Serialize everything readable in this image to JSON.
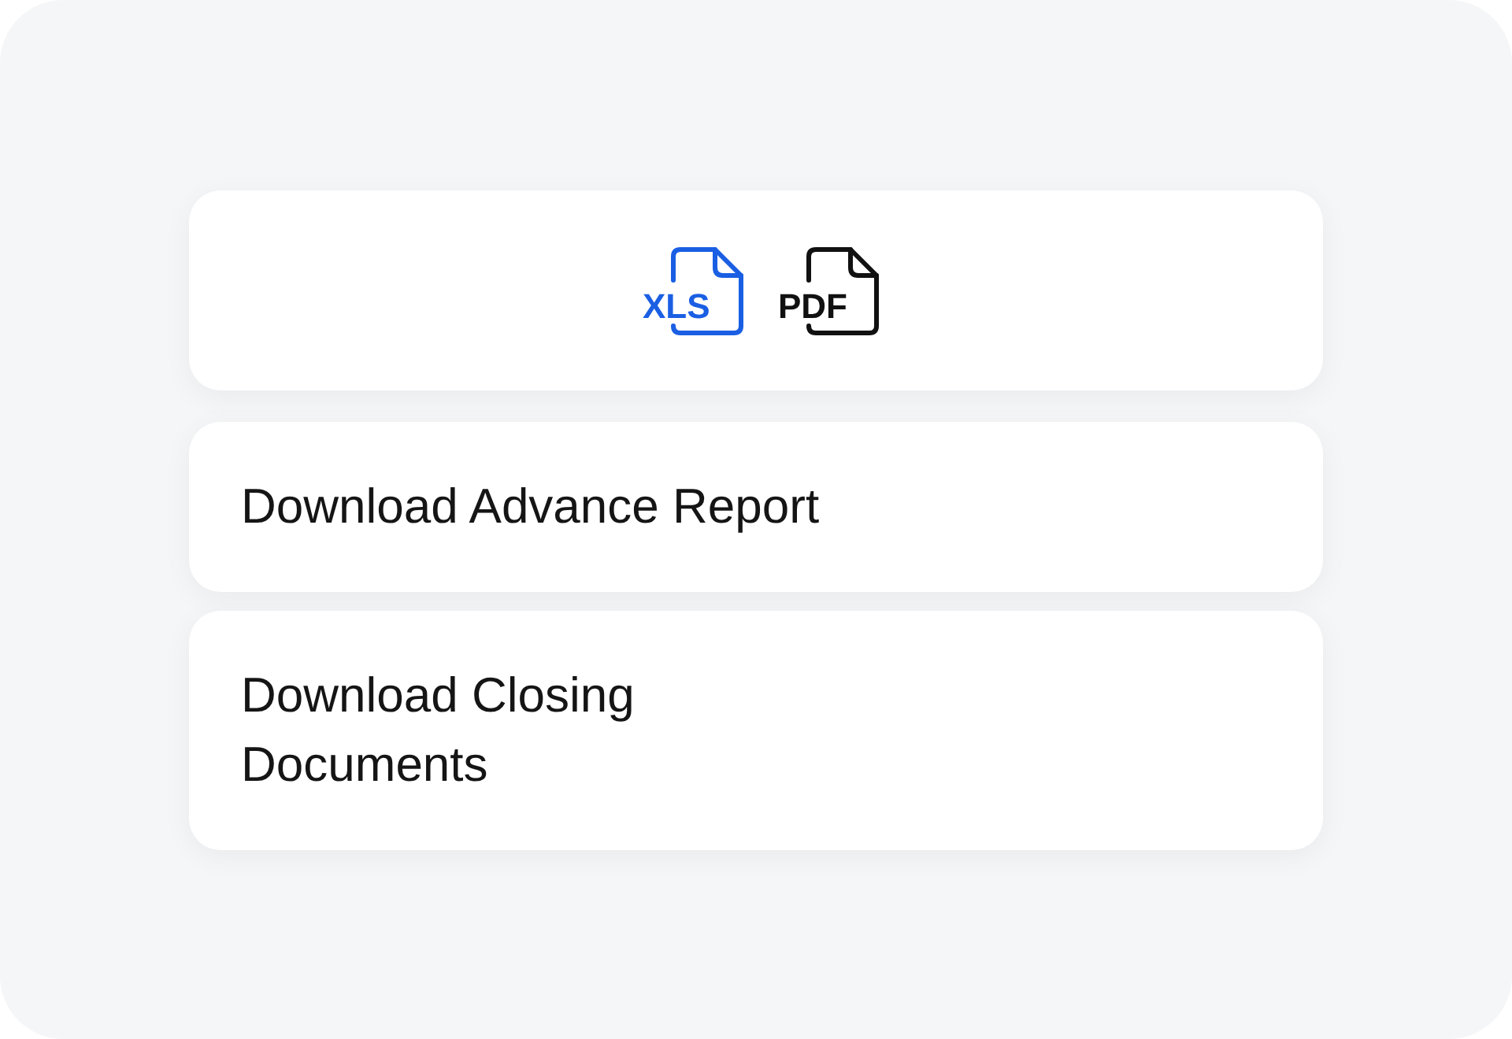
{
  "formats": [
    {
      "label": "XLS",
      "color": "#1a5fe3"
    },
    {
      "label": "PDF",
      "color": "#111111"
    }
  ],
  "actions": [
    "Download Advance Report",
    "Download Closing\nDocuments"
  ]
}
